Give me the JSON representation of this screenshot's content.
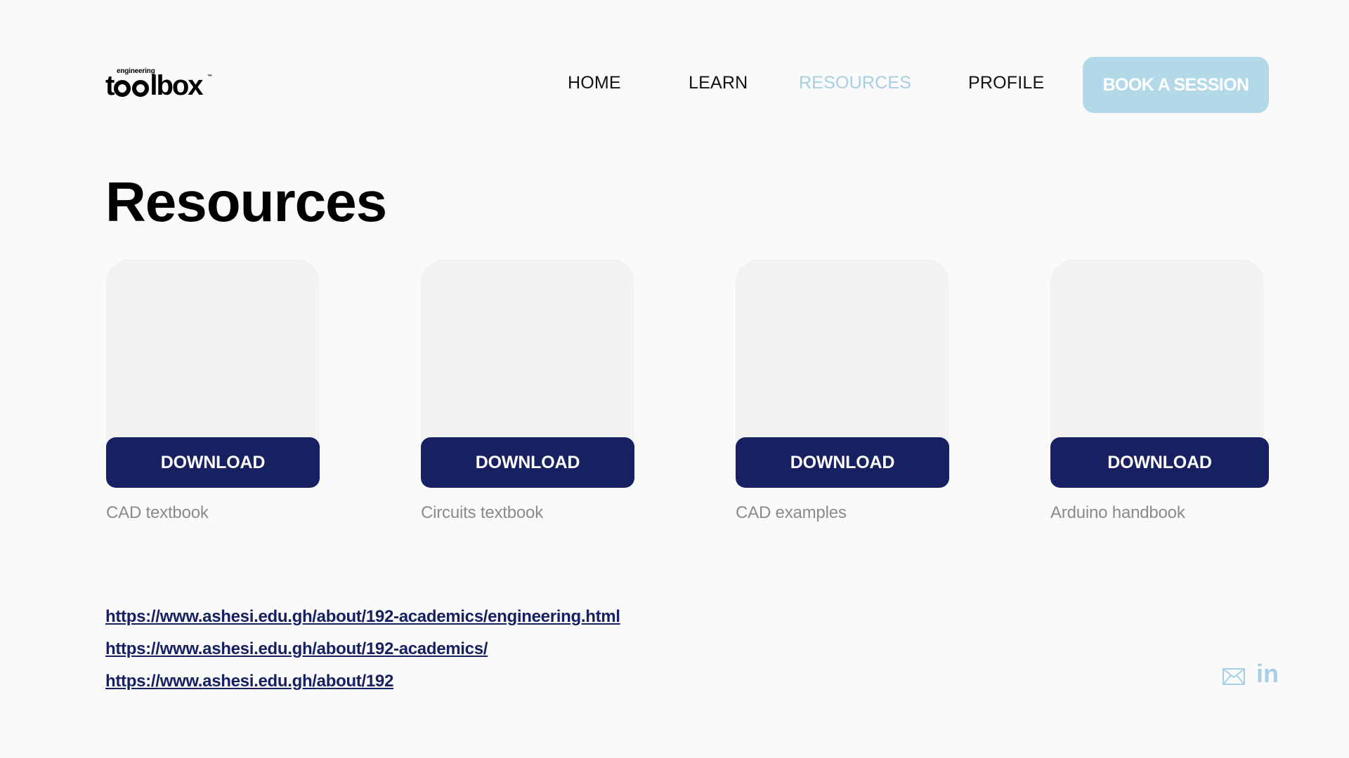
{
  "logo": {
    "small_word": "engineering",
    "big_prefix": "t",
    "big_suffix": "lbox",
    "tm": "™"
  },
  "nav": {
    "items": [
      {
        "label": "HOME",
        "active": false
      },
      {
        "label": "LEARN",
        "active": false
      },
      {
        "label": "RESOURCES",
        "active": true
      },
      {
        "label": "PROFILE",
        "active": false
      }
    ],
    "cta_label": "BOOK A SESSION"
  },
  "page": {
    "title": "Resources"
  },
  "resources": [
    {
      "button_label": "DOWNLOAD",
      "caption": "CAD textbook"
    },
    {
      "button_label": "DOWNLOAD",
      "caption": "Circuits textbook"
    },
    {
      "button_label": "DOWNLOAD",
      "caption": "CAD examples"
    },
    {
      "button_label": "DOWNLOAD",
      "caption": "Arduino handbook"
    }
  ],
  "links": [
    "https://www.ashesi.edu.gh/about/192-academics/engineering.html",
    "https://www.ashesi.edu.gh/about/192-academics/",
    "https://www.ashesi.edu.gh/about/192"
  ],
  "social": {
    "mail_icon": "mail-icon",
    "linkedin_icon": "linkedin-icon",
    "linkedin_text": "in"
  },
  "colors": {
    "background": "#fafafa",
    "accent_light_blue": "#b3d8e8",
    "navy": "#172162",
    "card_placeholder": "#f2f2f2",
    "caption_gray": "#8a8a8a"
  }
}
